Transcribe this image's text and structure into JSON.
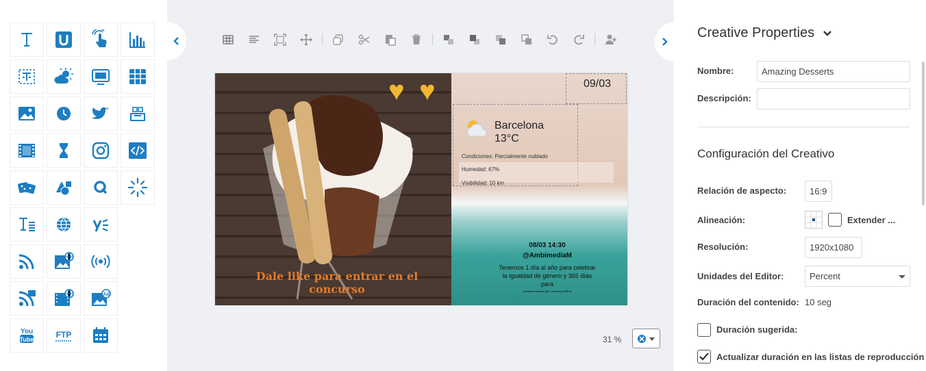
{
  "palette": {
    "tools": [
      {
        "name": "text-widget",
        "icon": "text-T-icon"
      },
      {
        "name": "u-widget",
        "icon": "u-badge-icon"
      },
      {
        "name": "touch-widget",
        "icon": "hand-touch-icon"
      },
      {
        "name": "chart-widget",
        "icon": "bar-chart-icon"
      },
      {
        "name": "ticker-widget",
        "icon": "text-frame-icon"
      },
      {
        "name": "weather-widget",
        "icon": "weather-icon"
      },
      {
        "name": "screen-widget",
        "icon": "monitor-icon"
      },
      {
        "name": "table-widget",
        "icon": "table-icon"
      },
      {
        "name": "image-widget",
        "icon": "image-icon"
      },
      {
        "name": "clock-widget",
        "icon": "clock-icon"
      },
      {
        "name": "twitter-widget",
        "icon": "twitter-icon"
      },
      {
        "name": "reservation-widget",
        "icon": "counter-icon"
      },
      {
        "name": "video-widget",
        "icon": "film-icon"
      },
      {
        "name": "timer-widget",
        "icon": "hourglass-icon"
      },
      {
        "name": "instagram-widget",
        "icon": "instagram-icon"
      },
      {
        "name": "html-widget",
        "icon": "code-icon"
      },
      {
        "name": "random-widget",
        "icon": "dice-icon"
      },
      {
        "name": "shapes-widget",
        "icon": "shapes-icon"
      },
      {
        "name": "queue-widget",
        "icon": "q-icon"
      },
      {
        "name": "loader-widget",
        "icon": "spinner-icon"
      },
      {
        "name": "richtext-widget",
        "icon": "text-lines-icon"
      },
      {
        "name": "web-widget",
        "icon": "globe-icon"
      },
      {
        "name": "yammer-widget",
        "icon": "yammer-icon"
      },
      {
        "name": "empty-slot",
        "icon": ""
      },
      {
        "name": "rss-widget",
        "icon": "rss-icon"
      },
      {
        "name": "web-image-widget",
        "icon": "web-image-icon"
      },
      {
        "name": "broadcast-widget",
        "icon": "broadcast-icon"
      },
      {
        "name": "empty-slot",
        "icon": ""
      },
      {
        "name": "rss-video-widget",
        "icon": "rss-alt-icon"
      },
      {
        "name": "web-video-widget",
        "icon": "web-video-icon"
      },
      {
        "name": "ad-widget",
        "icon": "ad-image-icon"
      },
      {
        "name": "empty-slot",
        "icon": ""
      },
      {
        "name": "youtube-widget",
        "icon": "youtube-icon",
        "label": "You Tube"
      },
      {
        "name": "ftp-widget",
        "icon": "ftp-icon",
        "label": "FTP"
      },
      {
        "name": "calendar-widget",
        "icon": "calendar-icon"
      }
    ]
  },
  "toolbar": {
    "buttons": [
      "grid-icon",
      "align-icon",
      "fit-icon",
      "move-icon",
      "copy-icon",
      "cut-icon",
      "paste-icon",
      "delete-icon",
      "bring-front-icon",
      "bring-forward-icon",
      "send-backward-icon",
      "send-back-icon",
      "undo-icon",
      "redo-icon",
      "add-user-icon"
    ]
  },
  "canvas": {
    "date": "09/03",
    "city": "Barcelona",
    "temperature": "13°C",
    "conditions": "Condiciones: Parcialmente nublado",
    "humidity": "Humedad: 67%",
    "visibility": "Visibilidad: 10 km",
    "post_time": "08/03 14:30",
    "post_user": "@AmbimediaM",
    "post_text": "Tenemos 1 día al año para celebrar la igualdad de género y 365 días para",
    "post_text_more": "conseguir ponerla",
    "promo": "Dale like para entrar en el concurso",
    "hearts": [
      "♥",
      "♥"
    ]
  },
  "zoom": {
    "value": "31 %"
  },
  "props": {
    "title": "Creative Properties",
    "nombre_label": "Nombre:",
    "nombre_value": "Amazing Desserts",
    "descripcion_label": "Descripción:",
    "descripcion_value": "",
    "config_title": "Configuración del Creativo",
    "aspect_label": "Relación de aspecto:",
    "aspect_value": "16:9",
    "align_label": "Alineación:",
    "extend_label": "Extender ...",
    "resolution_label": "Resolución:",
    "resolution_value": "1920x1080",
    "units_label": "Unidades del Editor:",
    "units_value": "Percent",
    "duration_label": "Duración del contenido:",
    "duration_value": "10 seg",
    "suggested_label": "Duración sugerida:",
    "suggested_checked": false,
    "update_label": "Actualizar duración en las listas de reproducción",
    "update_checked": true
  },
  "colors": {
    "accent": "#1d7ec2",
    "heart": "#f2b632",
    "promo": "#e27b2c"
  }
}
